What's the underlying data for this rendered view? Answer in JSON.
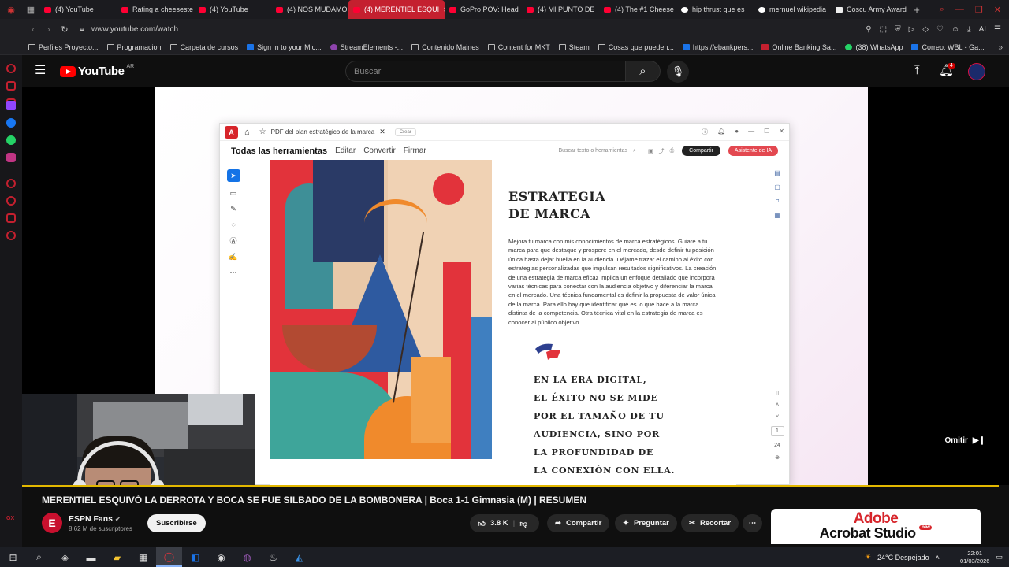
{
  "browser": {
    "tabs": [
      {
        "label": "(4) YouTube",
        "fav": "yt"
      },
      {
        "label": "Rating a cheeseste",
        "fav": "yt"
      },
      {
        "label": "(4) YouTube",
        "fav": "yt"
      },
      {
        "label": "(4) NOS MUDAMO",
        "fav": "yt"
      },
      {
        "label": "(4) MERENTIEL ESQUI",
        "fav": "yt",
        "active": true
      },
      {
        "label": "GoPro POV: Head",
        "fav": "yt"
      },
      {
        "label": "(4) MI PUNTO DE",
        "fav": "yt"
      },
      {
        "label": "(4) The #1 Cheese",
        "fav": "yt"
      },
      {
        "label": "hip thrust que es",
        "fav": "g"
      },
      {
        "label": "mernuel wikipedia",
        "fav": "g"
      },
      {
        "label": "Coscu Army Award",
        "fav": "w"
      }
    ],
    "url": "www.youtube.com/watch",
    "bookmarks": [
      {
        "label": "Perfiles Proyecto...",
        "icon": "folder"
      },
      {
        "label": "Programacion",
        "icon": "folder"
      },
      {
        "label": "Carpeta de cursos",
        "icon": "folder"
      },
      {
        "label": "Sign in to your Mic...",
        "icon": "ms"
      },
      {
        "label": "StreamElements -...",
        "icon": "se"
      },
      {
        "label": "Contenido Maines",
        "icon": "folder"
      },
      {
        "label": "Content for MKT",
        "icon": "folder"
      },
      {
        "label": "Steam",
        "icon": "folder"
      },
      {
        "label": "Cosas que pueden...",
        "icon": "folder"
      },
      {
        "label": "https://ebankpers...",
        "icon": "bp"
      },
      {
        "label": "Online Banking Sa...",
        "icon": "red"
      },
      {
        "label": "(38) WhatsApp",
        "icon": "wa"
      },
      {
        "label": "Correo: WBL - Ga...",
        "icon": "mail"
      }
    ]
  },
  "youtube": {
    "logo_text": "YouTube",
    "country": "AR",
    "search_placeholder": "Buscar",
    "notifications": "4"
  },
  "acrobat": {
    "doc_tab": "PDF del plan estratégico de la marca",
    "new_tab": "Crear",
    "menu": [
      "Todas las herramientas",
      "Editar",
      "Convertir",
      "Firmar"
    ],
    "find_placeholder": "Buscar texto o herramientas",
    "share": "Compartir",
    "ai": "Asistente de IA",
    "page_current": "1",
    "page_total": "24"
  },
  "document": {
    "heading1": "ESTRATEGIA",
    "heading2": "DE MARCA",
    "body": "Mejora tu marca con mis conocimientos de marca estratégicos. Guiaré a tu marca para que destaque y prospere en el mercado, desde definir tu posición única hasta dejar huella en la audiencia. Déjame trazar el camino al éxito con estrategias personalizadas que impulsan resultados significativos. La creación de una estrategia de marca eficaz implica un enfoque detallado que incorpora varias técnicas para conectar con la audiencia objetivo y diferenciar la marca en el mercado. Una técnica fundamental es definir la propuesta de valor única de la marca. Para ello hay que identificar qué es lo que hace a la marca distinta de la competencia. Otra técnica vital en la estrategia de marca es conocer al público objetivo.",
    "quote": [
      "EN LA ERA DIGITAL,",
      "EL ÉXITO NO SE MIDE",
      "POR EL TAMAÑO DE TU",
      "AUDIENCIA, SINO POR",
      "LA PROFUNDIDAD DE",
      "LA CONEXIÓN CON ELLA."
    ]
  },
  "player": {
    "skip_label": "Omitir",
    "progress": 0.99
  },
  "video": {
    "title": "MERENTIEL ESQUIVÓ LA DERROTA Y BOCA SE FUE SILBADO DE LA BOMBONERA | Boca 1-1 Gimnasia (M) | RESUMEN",
    "channel": "ESPN Fans",
    "channel_initial": "E",
    "subscribers": "8.62 M de suscriptores",
    "subscribe": "Suscribirse",
    "likes": "3.8 K",
    "share": "Compartir",
    "ask": "Preguntar",
    "clip": "Recortar"
  },
  "ad": {
    "line1": "Adobe",
    "line2": "Acrobat Studio",
    "tag": "new"
  },
  "taskbar": {
    "weather": "24°C  Despejado",
    "time": "22:01",
    "date": "01/03/2026"
  }
}
